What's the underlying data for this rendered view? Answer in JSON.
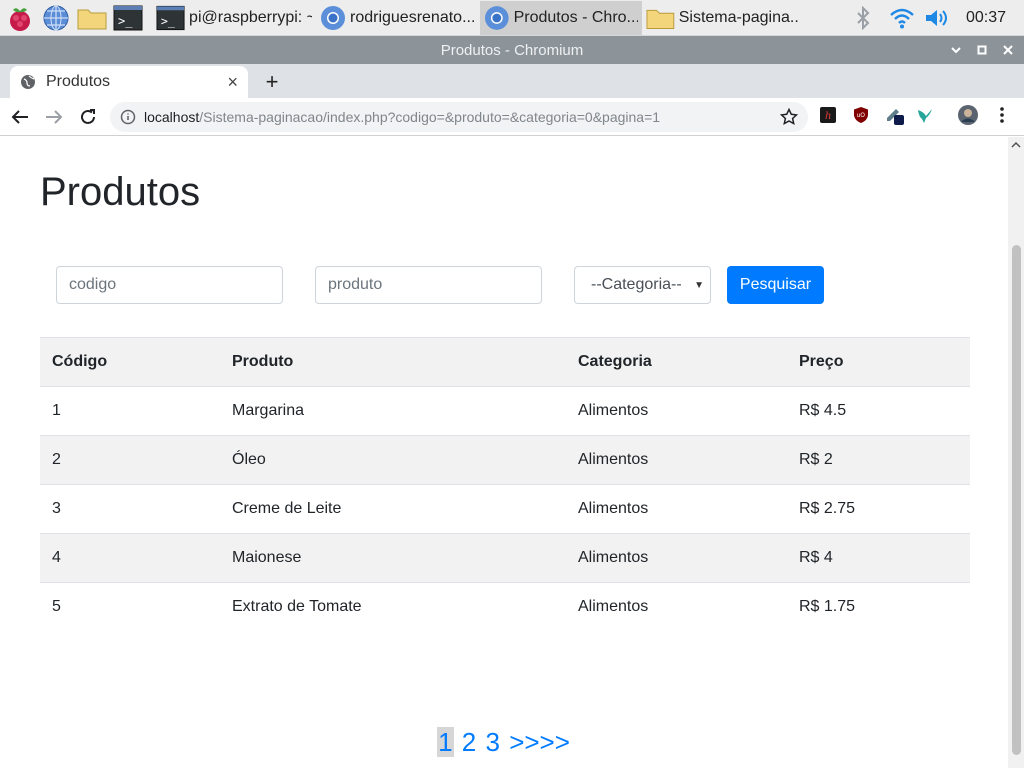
{
  "taskbar": {
    "tasks": [
      {
        "label": "pi@raspberrypi: ~"
      },
      {
        "label": "rodriguesrenato..."
      },
      {
        "label": "Produtos - Chro..."
      },
      {
        "label": "Sistema-pagina..."
      }
    ],
    "clock": "00:37"
  },
  "window": {
    "title": "Produtos - Chromium"
  },
  "tab": {
    "title": "Produtos",
    "close": "×",
    "new": "+"
  },
  "omnibox": {
    "host": "localhost",
    "path": "/Sistema-paginacao/index.php?codigo=&produto=&categoria=0&pagina=1"
  },
  "page": {
    "title": "Produtos",
    "form": {
      "codigo_placeholder": "codigo",
      "produto_placeholder": "produto",
      "categoria_selected": "--Categoria--",
      "search_label": "Pesquisar"
    },
    "table": {
      "headers": [
        "Código",
        "Produto",
        "Categoria",
        "Preço"
      ],
      "rows": [
        [
          "1",
          "Margarina",
          "Alimentos",
          "R$ 4.5"
        ],
        [
          "2",
          "Óleo",
          "Alimentos",
          "R$ 2"
        ],
        [
          "3",
          "Creme de Leite",
          "Alimentos",
          "R$ 2.75"
        ],
        [
          "4",
          "Maionese",
          "Alimentos",
          "R$ 4"
        ],
        [
          "5",
          "Extrato de Tomate",
          "Alimentos",
          "R$ 1.75"
        ]
      ]
    },
    "pagination": {
      "pages": [
        "1",
        "2",
        "3"
      ],
      "next": ">>>>",
      "current": "1"
    }
  },
  "colors": {
    "accent": "#007bff",
    "titlebar": "#8c949a"
  }
}
